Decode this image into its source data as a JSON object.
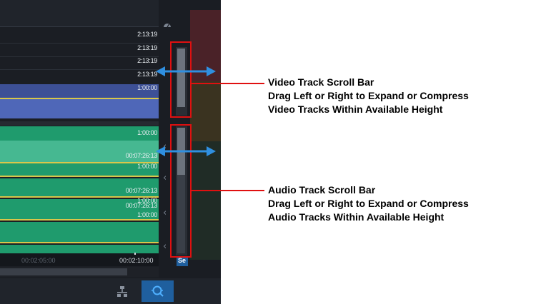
{
  "video_section": {
    "timecodes": [
      "2:13:19",
      "2:13:19",
      "2:13:19",
      "2:13:19",
      "1:00:00"
    ]
  },
  "audio_section": {
    "timecodes": [
      "1:00:00",
      "00:07:26:13",
      "1:00:00",
      "00:07:26:13",
      "1:00:00",
      "00:07:26:13",
      "1:00:00"
    ]
  },
  "timeline_ruler": {
    "labels": [
      "00:02:05:00",
      "00:02:10:00"
    ]
  },
  "cut_label": "Se",
  "toolbar": {
    "icons": [
      "track-layout-icon",
      "zoom-fit-icon"
    ]
  },
  "callouts": {
    "video": {
      "title": "Video Track Scroll Bar",
      "line2": "Drag Left or Right to Expand or Compress",
      "line3": "Video Tracks Within Available Height"
    },
    "audio": {
      "title": "Audio Track Scroll Bar",
      "line2": "Drag Left or Right to Expand or Compress",
      "line3": "Audio Tracks Within Available Height"
    }
  },
  "colors": {
    "panel_bg": "#1b1e24",
    "video_clip": "#4f67b8",
    "audio_clip": "#1f9b6d",
    "waveform_clip": "#46b891",
    "highlight_red": "#e01010",
    "arrow_blue": "#2f8fe0",
    "active_tool": "#1f5f9e"
  }
}
